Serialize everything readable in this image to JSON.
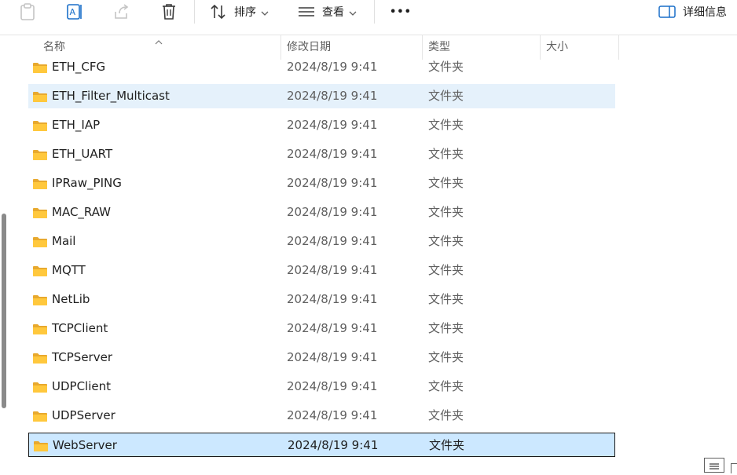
{
  "toolbar": {
    "sort_label": "排序",
    "view_label": "查看",
    "more_label": "•••",
    "details_label": "详细信息"
  },
  "columns": {
    "name": "名称",
    "date": "修改日期",
    "type": "类型",
    "size": "大小"
  },
  "rows": [
    {
      "name": "ETH_CFG",
      "date": "2024/8/19 9:41",
      "type": "文件夹"
    },
    {
      "name": "ETH_Filter_Multicast",
      "date": "2024/8/19 9:41",
      "type": "文件夹"
    },
    {
      "name": "ETH_IAP",
      "date": "2024/8/19 9:41",
      "type": "文件夹"
    },
    {
      "name": "ETH_UART",
      "date": "2024/8/19 9:41",
      "type": "文件夹"
    },
    {
      "name": "IPRaw_PING",
      "date": "2024/8/19 9:41",
      "type": "文件夹"
    },
    {
      "name": "MAC_RAW",
      "date": "2024/8/19 9:41",
      "type": "文件夹"
    },
    {
      "name": "Mail",
      "date": "2024/8/19 9:41",
      "type": "文件夹"
    },
    {
      "name": "MQTT",
      "date": "2024/8/19 9:41",
      "type": "文件夹"
    },
    {
      "name": "NetLib",
      "date": "2024/8/19 9:41",
      "type": "文件夹"
    },
    {
      "name": "TCPClient",
      "date": "2024/8/19 9:41",
      "type": "文件夹"
    },
    {
      "name": "TCPServer",
      "date": "2024/8/19 9:41",
      "type": "文件夹"
    },
    {
      "name": "UDPClient",
      "date": "2024/8/19 9:41",
      "type": "文件夹"
    },
    {
      "name": "UDPServer",
      "date": "2024/8/19 9:41",
      "type": "文件夹"
    },
    {
      "name": "WebServer",
      "date": "2024/8/19 9:41",
      "type": "文件夹"
    }
  ],
  "colors": {
    "hover_row": "#e5f1fb",
    "selected_row": "#cce8ff",
    "folder_fill": "#ffc83d",
    "folder_tab": "#e8a92e"
  }
}
